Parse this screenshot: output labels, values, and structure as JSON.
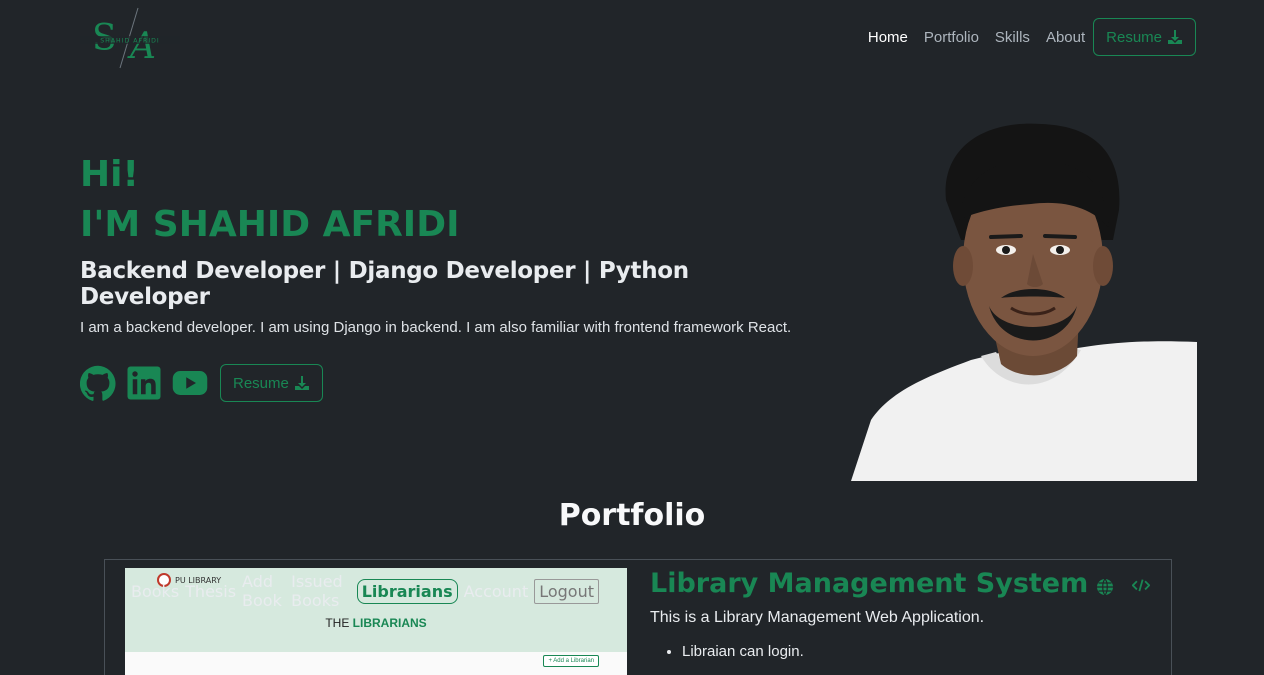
{
  "brand": {
    "logo_initials": "S/A",
    "logo_text": "SHAHID AFRIDI",
    "accent": "#198754"
  },
  "nav": {
    "items": [
      {
        "label": "Home"
      },
      {
        "label": "Portfolio"
      },
      {
        "label": "Skills"
      },
      {
        "label": "About"
      }
    ],
    "resume_label": "Resume"
  },
  "hero": {
    "greeting": "Hi!",
    "name": "I'M SHAHID AFRIDI",
    "roles": "Backend Developer | Django Developer | Python Developer",
    "bio": "I am a backend developer. I am using Django in backend. I am also familiar with frontend framework React.",
    "resume_label": "Resume",
    "socials": [
      "github-icon",
      "linkedin-icon",
      "youtube-icon"
    ]
  },
  "portfolio": {
    "title": "Portfolio",
    "projects": [
      {
        "title": "Library Management System",
        "description": "This is a Library Management Web Application.",
        "features": [
          "Libraian can login."
        ],
        "screenshot": {
          "brand": "PU LIBRARY",
          "links": [
            "Books",
            "Thesis",
            "Add Book",
            "Issued Books",
            "Librarians",
            "Account",
            "Logout"
          ],
          "heading_plain": "THE",
          "heading_accent": "LIBRARIANS",
          "add_button": "+ Add a Librarian"
        }
      }
    ]
  }
}
